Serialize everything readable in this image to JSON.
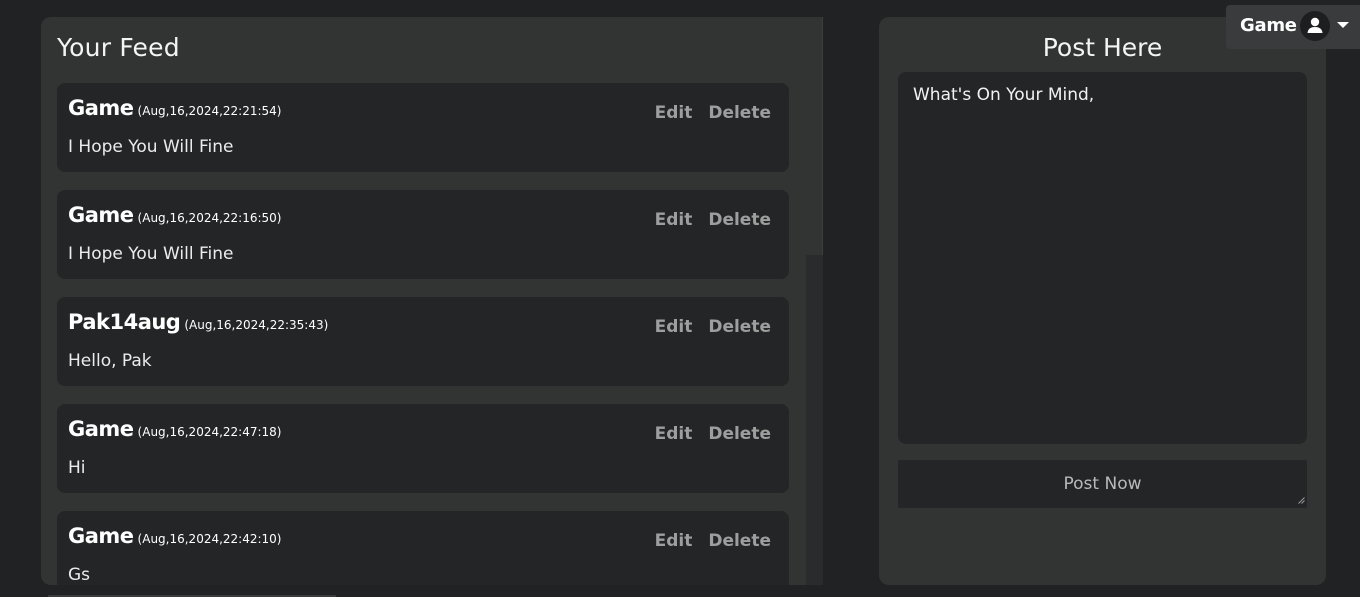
{
  "feed": {
    "title": "Your Feed",
    "posts": [
      {
        "author": "Game",
        "time": "(Aug,16,2024,22:21:54)",
        "body": "I Hope You Will Fine",
        "edit": "Edit",
        "delete": "Delete"
      },
      {
        "author": "Game",
        "time": "(Aug,16,2024,22:16:50)",
        "body": "I Hope You Will Fine",
        "edit": "Edit",
        "delete": "Delete"
      },
      {
        "author": "Pak14aug",
        "time": "(Aug,16,2024,22:35:43)",
        "body": "Hello, Pak",
        "edit": "Edit",
        "delete": "Delete"
      },
      {
        "author": "Game",
        "time": "(Aug,16,2024,22:47:18)",
        "body": "Hi",
        "edit": "Edit",
        "delete": "Delete"
      },
      {
        "author": "Game",
        "time": "(Aug,16,2024,22:42:10)",
        "body": "Gs",
        "edit": "Edit",
        "delete": "Delete"
      }
    ]
  },
  "compose": {
    "title": "Post Here",
    "placeholder": "What's On Your Mind,",
    "button": "Post Now"
  },
  "user_menu": {
    "name": "Game",
    "avatar_icon": "user-icon",
    "caret_icon": "caret-down-icon"
  },
  "colors": {
    "background": "#212224",
    "panel": "#323333",
    "card": "#242526",
    "action_text": "#9e9e9e"
  }
}
